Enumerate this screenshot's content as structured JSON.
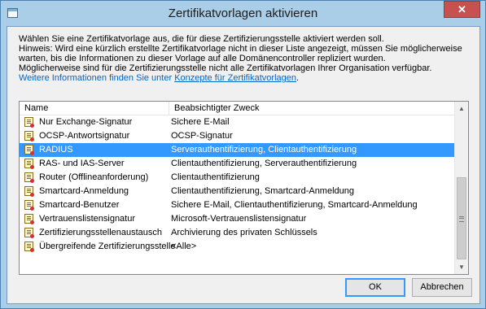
{
  "window": {
    "title": "Zertifikatvorlagen aktivieren",
    "close_glyph": "✕"
  },
  "description": {
    "line1": "Wählen Sie eine Zertifikatvorlage aus, die für diese Zertifizierungsstelle aktiviert werden soll.",
    "line2": "Hinweis: Wird eine kürzlich erstellte Zertifikatvorlage nicht in dieser Liste angezeigt, müssen Sie möglicherweise",
    "line3": "warten, bis die Informationen zu dieser Vorlage auf alle Domänencontroller repliziert wurden.",
    "line4": "Möglicherweise sind für die Zertifizierungsstelle nicht alle Zertifikatvorlagen Ihrer Organisation verfügbar.",
    "info_prefix": "Weitere Informationen finden Sie unter ",
    "info_link": "Konzepte für Zertifikatvorlagen",
    "info_suffix": "."
  },
  "list": {
    "columns": {
      "name": "Name",
      "purpose": "Beabsichtigter Zweck"
    },
    "rows": [
      {
        "name": "Nur Exchange-Signatur",
        "purpose": "Sichere E-Mail"
      },
      {
        "name": "OCSP-Antwortsignatur",
        "purpose": "OCSP-Signatur"
      },
      {
        "name": "RADIUS",
        "purpose": "Serverauthentifizierung, Clientauthentifizierung",
        "selected": true
      },
      {
        "name": "RAS- und IAS-Server",
        "purpose": "Clientauthentifizierung, Serverauthentifizierung"
      },
      {
        "name": "Router (Offlineanforderung)",
        "purpose": "Clientauthentifizierung"
      },
      {
        "name": "Smartcard-Anmeldung",
        "purpose": "Clientauthentifizierung, Smartcard-Anmeldung"
      },
      {
        "name": "Smartcard-Benutzer",
        "purpose": "Sichere E-Mail, Clientauthentifizierung, Smartcard-Anmeldung"
      },
      {
        "name": "Vertrauenslistensignatur",
        "purpose": "Microsoft-Vertrauenslistensignatur"
      },
      {
        "name": "Zertifizierungsstellenaustausch",
        "purpose": "Archivierung des privaten Schlüssels"
      },
      {
        "name": "Übergreifende Zertifizierungsstelle",
        "purpose": "<Alle>"
      }
    ],
    "icon": "certificate-template-icon",
    "scroll_up_glyph": "▲",
    "scroll_down_glyph": "▼"
  },
  "buttons": {
    "ok": "OK",
    "cancel": "Abbrechen"
  },
  "colors": {
    "selection": "#3399ff",
    "link": "#0066cc",
    "frame": "#aacde8",
    "close": "#c75050"
  }
}
